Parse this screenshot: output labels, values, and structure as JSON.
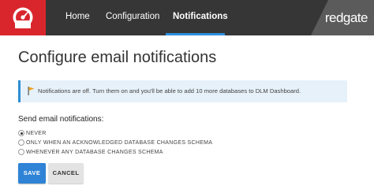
{
  "nav": {
    "items": [
      {
        "label": "Home",
        "active": false
      },
      {
        "label": "Configuration",
        "active": false
      },
      {
        "label": "Notifications",
        "active": true
      }
    ],
    "brand": "redgate",
    "colors": {
      "bar": "#363636",
      "logo": "#d9262d",
      "active_underline": "#2f8fe0"
    }
  },
  "main": {
    "title": "Configure email notifications",
    "alert": {
      "icon": "flag-icon",
      "text": "Notifications are off. Turn them on and you'll be able to add 10 more databases to DLM Dashboard."
    },
    "send_label": "Send email notifications:",
    "options": [
      {
        "label": "NEVER",
        "selected": true
      },
      {
        "label": "ONLY WHEN AN ACKNOWLEDGED DATABASE CHANGES SCHEMA",
        "selected": false
      },
      {
        "label": "WHENEVER ANY DATABASE CHANGES SCHEMA",
        "selected": false
      }
    ],
    "buttons": {
      "save": "SAVE",
      "cancel": "CANCEL"
    }
  }
}
